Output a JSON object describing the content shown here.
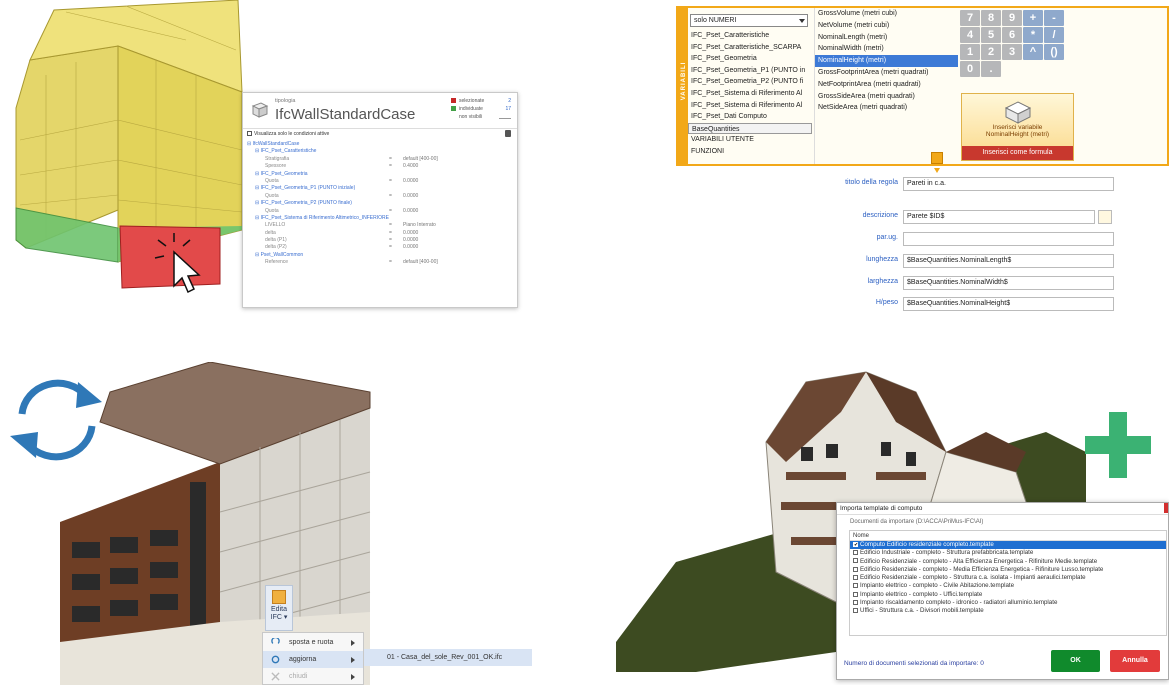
{
  "ifc_panel": {
    "tipologia_label": "tipologia",
    "type_name": "IfcWallStandardCase",
    "stats": [
      {
        "label": "selezionate",
        "value": "2",
        "color": "#c62828"
      },
      {
        "label": "individuate",
        "value": "17",
        "color": "#43a047"
      },
      {
        "label": "non visibili",
        "value": ""
      }
    ],
    "show_active_label": "Visualizza solo le condizioni attive",
    "rows": [
      {
        "level": "lv0",
        "key": "⊟ IfcWallStandardCase",
        "eq": "",
        "val": ""
      },
      {
        "level": "lv1",
        "key": "⊟ IFC_Pset_Caratteristiche",
        "eq": "",
        "val": ""
      },
      {
        "level": "lv2",
        "key": "Stratigrafia",
        "eq": "=",
        "val": "default [400-00]"
      },
      {
        "level": "lv2",
        "key": "Spessore",
        "eq": "=",
        "val": "0.4000"
      },
      {
        "level": "lv1",
        "key": "⊟ IFC_Pset_Geometria",
        "eq": "",
        "val": ""
      },
      {
        "level": "lv2",
        "key": "Quota",
        "eq": "=",
        "val": "0.0000"
      },
      {
        "level": "lv1",
        "key": "⊟ IFC_Pset_Geometria_P1 (PUNTO iniziale)",
        "eq": "",
        "val": ""
      },
      {
        "level": "lv2",
        "key": "Quota",
        "eq": "=",
        "val": "0.0000"
      },
      {
        "level": "lv1",
        "key": "⊟ IFC_Pset_Geometria_P2 (PUNTO finale)",
        "eq": "",
        "val": ""
      },
      {
        "level": "lv2",
        "key": "Quota",
        "eq": "=",
        "val": "0.0000"
      },
      {
        "level": "lv1",
        "key": "⊟ IFC_Pset_Sistema di Riferimento Altimetrico_INFERIORE",
        "eq": "",
        "val": ""
      },
      {
        "level": "lv2",
        "key": "LIVELLO",
        "eq": "=",
        "val": "Piano Interrato"
      },
      {
        "level": "lv2",
        "key": "delta",
        "eq": "=",
        "val": "0.0000"
      },
      {
        "level": "lv2",
        "key": "delta (P1)",
        "eq": "=",
        "val": "0.0000"
      },
      {
        "level": "lv2",
        "key": "delta (P2)",
        "eq": "=",
        "val": "0.0000"
      },
      {
        "level": "lv1",
        "key": "⊟ Pset_WallCommon",
        "eq": "",
        "val": ""
      },
      {
        "level": "lv2",
        "key": "Reference",
        "eq": "=",
        "val": "default [400-00]"
      }
    ]
  },
  "variables": {
    "side_label": "VARIABILI",
    "dropdown_value": "solo NUMERI",
    "groups": [
      "IFC_Pset_Caratteristiche",
      "IFC_Pset_Caratteristiche_SCARPA",
      "IFC_Pset_Geometria",
      "IFC_Pset_Geometria_P1 (PUNTO in",
      "IFC_Pset_Geometria_P2 (PUNTO fi",
      "IFC_Pset_Sistema di Riferimento Al",
      "IFC_Pset_Sistema di Riferimento Al",
      "IFC_Pset_Dati Computo",
      "BaseQuantities",
      "VARIABILI UTENTE",
      "FUNZIONI"
    ],
    "selected_group": 8,
    "fields": [
      "GrossVolume (metri cubi)",
      "NetVolume (metri cubi)",
      "NominalLength (metri)",
      "NominalWidth (metri)",
      "NominalHeight (metri)",
      "GrossFootprintArea (metri quadrati)",
      "NetFootprintArea (metri quadrati)",
      "GrossSideArea (metri quadrati)",
      "NetSideArea (metri quadrati)"
    ],
    "selected_field": 4,
    "keypad": [
      [
        "7",
        "8",
        "9",
        "+",
        "-"
      ],
      [
        "4",
        "5",
        "6",
        "*",
        "/"
      ],
      [
        "1",
        "2",
        "3",
        "^",
        "()"
      ],
      [
        "0",
        ".",
        "",
        "",
        ""
      ]
    ],
    "insert_label_1": "Inserisci variabile",
    "insert_label_2": "NominalHeight (metri)",
    "insert_formula_label": "Inserisci come formula"
  },
  "rule_form": {
    "fields": [
      {
        "label": "titolo della regola",
        "value": "Pareti in c.a."
      },
      {
        "label": "descrizione",
        "value": "Parete $ID$"
      },
      {
        "label": "par.ug.",
        "value": ""
      },
      {
        "label": "lunghezza",
        "value": "$BaseQuantities.NominalLength$"
      },
      {
        "label": "larghezza",
        "value": "$BaseQuantities.NominalWidth$"
      },
      {
        "label": "H/peso",
        "value": "$BaseQuantities.NominalHeight$"
      }
    ]
  },
  "edit_menu": {
    "edit_button": "Edita IFC ▾",
    "items": [
      {
        "label": "sposta e ruota",
        "state": "normal"
      },
      {
        "label": "aggiorna",
        "state": "highlight"
      },
      {
        "label": "chiudi",
        "state": "disabled"
      }
    ],
    "submenu_file": "01 - Casa_del_sole_Rev_001_OK.ifc"
  },
  "import_dialog": {
    "title": "Importa template di computo",
    "path_label": "Documenti da importare (D:\\ACCA\\PriMus-IFC\\AI)",
    "column_header": "Nome",
    "items": [
      {
        "name": "Computo Edificio residenziale completo.template",
        "checked": true
      },
      {
        "name": "Edificio Industriale - completo - Struttura prefabbricata.template",
        "checked": false
      },
      {
        "name": "Edificio Residenziale - completo - Alta Efficienza Energetica - Rifiniture Medie.template",
        "checked": false
      },
      {
        "name": "Edificio Residenziale - completo - Media Efficienza Energetica - Rifiniture Lusso.template",
        "checked": false
      },
      {
        "name": "Edificio Residenziale - completo - Struttura c.a. isolata - Impianti aeraulici.template",
        "checked": false
      },
      {
        "name": "Impianto elettrico - completo - Civile Abitazione.template",
        "checked": false
      },
      {
        "name": "Impianto elettrico - completo - Uffici.template",
        "checked": false
      },
      {
        "name": "Impianto riscaldamento completo - idronico - radiatori alluminio.template",
        "checked": false
      },
      {
        "name": "Uffici - Struttura c.a. - Divisori mobili.template",
        "checked": false
      }
    ],
    "count_label": "Numero di documenti selezionati da importare: 0",
    "ok_label": "OK",
    "cancel_label": "Annulla"
  },
  "colors": {
    "accent_orange": "#f2a818",
    "plus_green": "#3bb273",
    "refresh_blue": "#2f78b7",
    "ok_green": "#108a2c",
    "cancel_red": "#e23b3b"
  }
}
